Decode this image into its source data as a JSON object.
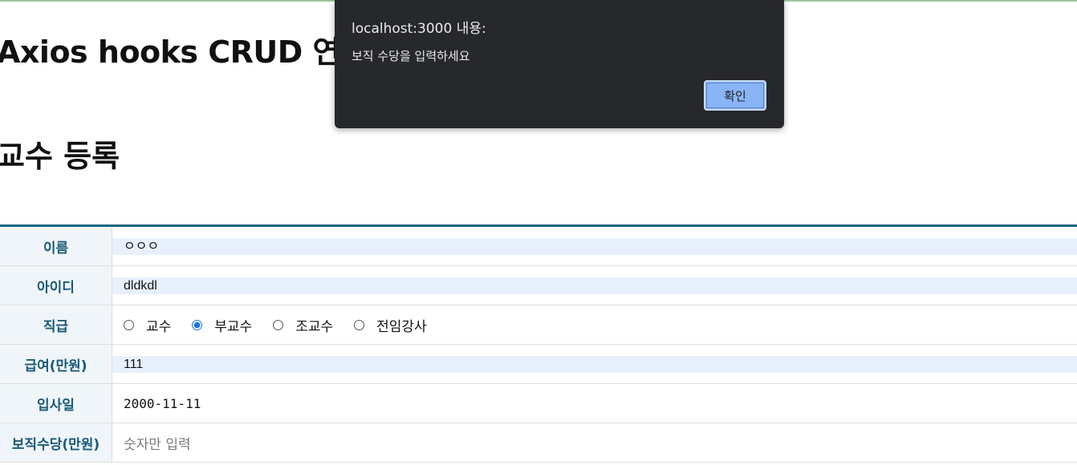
{
  "page": {
    "app_title": "Axios hooks CRUD 연습",
    "section_title": "교수 등록"
  },
  "form": {
    "name": {
      "label": "이름",
      "value": "ㅇㅇㅇ"
    },
    "userid": {
      "label": "아이디",
      "value": "dldkdl"
    },
    "position": {
      "label": "직급",
      "options": [
        "교수",
        "부교수",
        "조교수",
        "전임강사"
      ],
      "selected": "부교수"
    },
    "salary": {
      "label": "급여(만원)",
      "value": "111"
    },
    "hiredate": {
      "label": "입사일",
      "value": "2000-11-11"
    },
    "bonus": {
      "label": "보직수당(만원)",
      "value": "",
      "placeholder": "숫자만 입력"
    }
  },
  "dialog": {
    "title": "localhost:3000 내용:",
    "message": "보직 수당을 입력하세요",
    "ok_label": "확인",
    "background_color": "#27282c",
    "button_color": "#8ab4f8"
  },
  "colors": {
    "header_border": "#1e6583",
    "label_text": "#1a5a78",
    "label_bg": "#f0f5f9",
    "autofill_bg": "#e8f0fe"
  }
}
